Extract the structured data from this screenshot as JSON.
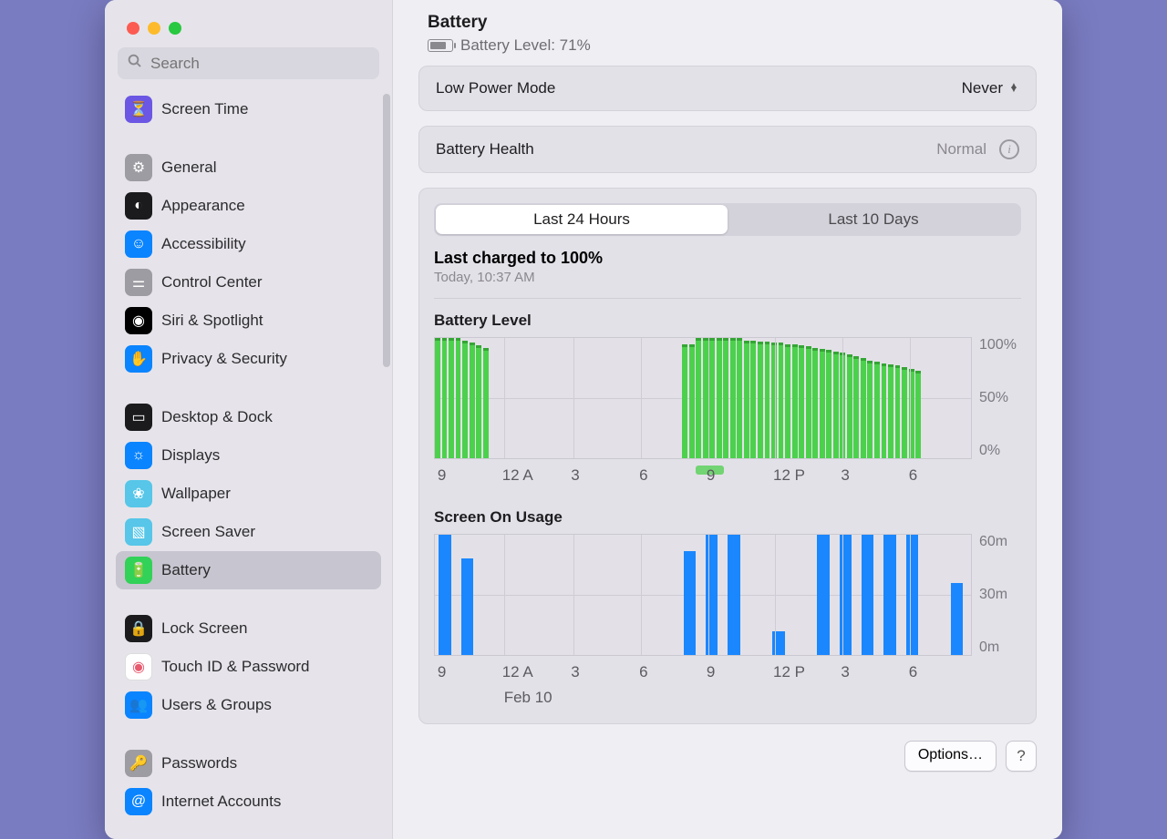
{
  "window": {
    "title": "Battery"
  },
  "search": {
    "placeholder": "Search"
  },
  "sidebar": {
    "items": [
      {
        "label": "Screen Time",
        "icon": "hourglass-icon",
        "bg": "#6b57e3"
      },
      {
        "label": "General",
        "icon": "gear-icon",
        "bg": "#9d9ca2"
      },
      {
        "label": "Appearance",
        "icon": "contrast-icon",
        "bg": "#1b1b1d"
      },
      {
        "label": "Accessibility",
        "icon": "person-icon",
        "bg": "#0a84ff"
      },
      {
        "label": "Control Center",
        "icon": "switches-icon",
        "bg": "#9d9ca2"
      },
      {
        "label": "Siri & Spotlight",
        "icon": "siri-icon",
        "bg": "#000"
      },
      {
        "label": "Privacy & Security",
        "icon": "hand-icon",
        "bg": "#0a84ff"
      },
      {
        "label": "Desktop & Dock",
        "icon": "dock-icon",
        "bg": "#1b1b1d"
      },
      {
        "label": "Displays",
        "icon": "sun-icon",
        "bg": "#0a84ff"
      },
      {
        "label": "Wallpaper",
        "icon": "flower-icon",
        "bg": "#57c6e8"
      },
      {
        "label": "Screen Saver",
        "icon": "screensaver-icon",
        "bg": "#57c6e8"
      },
      {
        "label": "Battery",
        "icon": "battery-icon",
        "bg": "#32d158"
      },
      {
        "label": "Lock Screen",
        "icon": "lock-icon",
        "bg": "#1b1b1d"
      },
      {
        "label": "Touch ID & Password",
        "icon": "fingerprint-icon",
        "bg": "#fff"
      },
      {
        "label": "Users & Groups",
        "icon": "users-icon",
        "bg": "#0a84ff"
      },
      {
        "label": "Passwords",
        "icon": "key-icon",
        "bg": "#9d9ca2"
      },
      {
        "label": "Internet Accounts",
        "icon": "at-icon",
        "bg": "#0a84ff"
      }
    ],
    "selected": "Battery"
  },
  "header": {
    "title": "Battery",
    "level_label": "Battery Level: 71%"
  },
  "low_power": {
    "label": "Low Power Mode",
    "value": "Never"
  },
  "health": {
    "label": "Battery Health",
    "value": "Normal"
  },
  "tabs": {
    "a": "Last 24 Hours",
    "b": "Last 10 Days",
    "active": "a"
  },
  "charge_info": {
    "title": "Last charged to 100%",
    "time": "Today, 10:37 AM"
  },
  "chart1_title": "Battery Level",
  "chart2_title": "Screen On Usage",
  "chart_data": [
    {
      "type": "bar",
      "title": "Battery Level",
      "categories_hours": [
        "9",
        "12 A",
        "3",
        "6",
        "9",
        "12 P",
        "3",
        "6"
      ],
      "ylim": [
        0,
        100
      ],
      "y_ticks": [
        "100%",
        "50%",
        "0%"
      ],
      "values_pct": [
        100,
        100,
        100,
        100,
        98,
        96,
        94,
        92,
        0,
        0,
        0,
        0,
        0,
        0,
        0,
        0,
        0,
        0,
        0,
        0,
        0,
        0,
        0,
        0,
        0,
        0,
        0,
        0,
        0,
        0,
        0,
        0,
        0,
        0,
        0,
        0,
        95,
        95,
        100,
        100,
        100,
        100,
        100,
        100,
        100,
        98,
        98,
        97,
        97,
        96,
        96,
        95,
        95,
        94,
        93,
        92,
        91,
        90,
        89,
        88,
        86,
        85,
        83,
        81,
        80,
        79,
        78,
        77,
        76,
        74,
        73,
        0,
        0,
        0,
        0,
        0,
        0,
        0
      ],
      "charging_segment_start_idx": 38,
      "charging_segment_width_bars": 4
    },
    {
      "type": "bar",
      "title": "Screen On Usage (minutes per hour)",
      "categories_hours": [
        "9",
        "12 A",
        "3",
        "6",
        "9",
        "12 P",
        "3",
        "6"
      ],
      "date_sublabel": "Feb 10",
      "ylim": [
        0,
        60
      ],
      "y_ticks": [
        "60m",
        "30m",
        "0m"
      ],
      "values_min": [
        60,
        48,
        0,
        0,
        0,
        0,
        0,
        0,
        0,
        0,
        0,
        52,
        60,
        60,
        0,
        12,
        0,
        60,
        60,
        60,
        60,
        60,
        0,
        36
      ],
      "hour_positions": [
        0,
        1,
        11,
        12,
        13,
        15,
        17,
        18,
        19,
        20,
        21,
        23
      ]
    }
  ],
  "xticks": [
    {
      "label": "9",
      "pct": 1.0
    },
    {
      "label": "12 A",
      "pct": 13.0
    },
    {
      "label": "3",
      "pct": 25.8
    },
    {
      "label": "6",
      "pct": 38.5
    },
    {
      "label": "9",
      "pct": 51.0
    },
    {
      "label": "12 P",
      "pct": 63.4
    },
    {
      "label": "3",
      "pct": 76.0
    },
    {
      "label": "6",
      "pct": 88.6
    }
  ],
  "footer": {
    "options": "Options…",
    "help": "?"
  }
}
